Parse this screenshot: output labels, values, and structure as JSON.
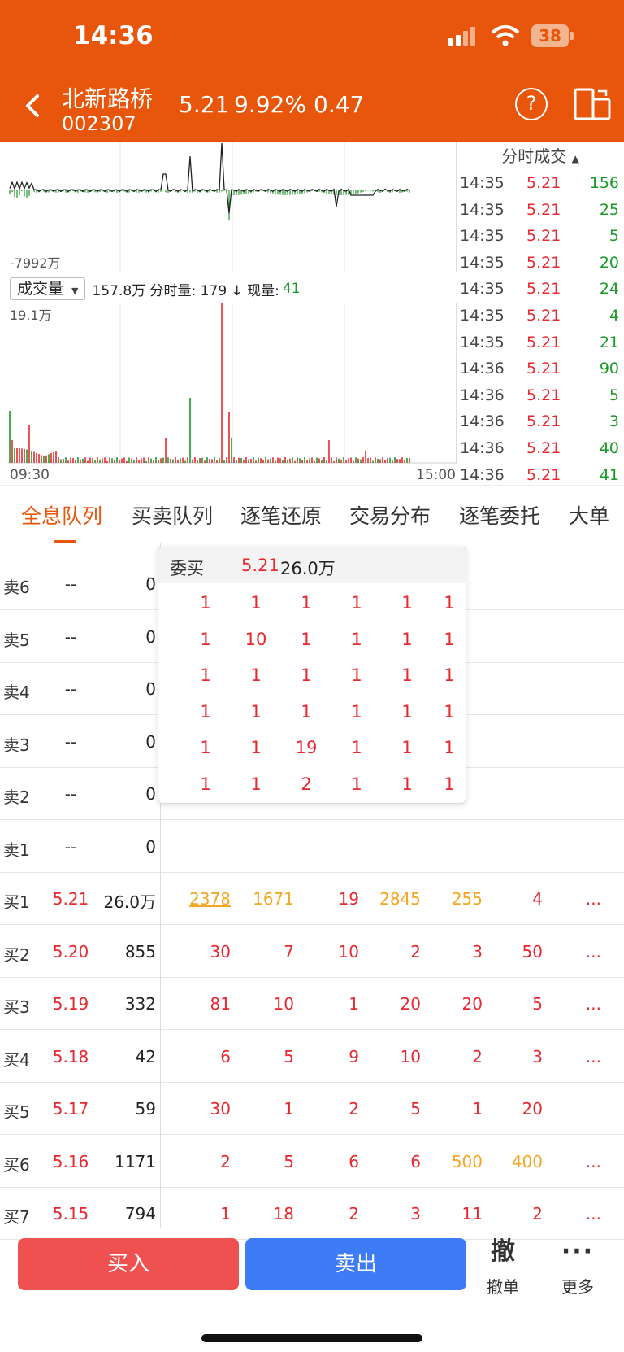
{
  "status": {
    "time": "14:36",
    "battery": "38"
  },
  "stock": {
    "name": "北新路桥",
    "code": "002307",
    "price": "5.21",
    "pct": "9.92%",
    "change": "0.47"
  },
  "chart": {
    "flow_label": "-7992万",
    "vol_select": "成交量",
    "vol_info": "157.8万 分时量: 179 ↓ 现量:",
    "vol_now": "41",
    "vol_max": "19.1万",
    "t_start": "09:30",
    "t_end": "15:00"
  },
  "ticks": {
    "header": "分时成交",
    "rows": [
      {
        "time": "14:35",
        "price": "5.21",
        "vol": "156"
      },
      {
        "time": "14:35",
        "price": "5.21",
        "vol": "25"
      },
      {
        "time": "14:35",
        "price": "5.21",
        "vol": "5"
      },
      {
        "time": "14:35",
        "price": "5.21",
        "vol": "20"
      },
      {
        "time": "14:35",
        "price": "5.21",
        "vol": "24"
      },
      {
        "time": "14:35",
        "price": "5.21",
        "vol": "4"
      },
      {
        "time": "14:35",
        "price": "5.21",
        "vol": "21"
      },
      {
        "time": "14:36",
        "price": "5.21",
        "vol": "90"
      },
      {
        "time": "14:36",
        "price": "5.21",
        "vol": "5"
      },
      {
        "time": "14:36",
        "price": "5.21",
        "vol": "3"
      },
      {
        "time": "14:36",
        "price": "5.21",
        "vol": "40"
      },
      {
        "time": "14:36",
        "price": "5.21",
        "vol": "41"
      }
    ]
  },
  "tabs": [
    "全息队列",
    "买卖队列",
    "逐笔还原",
    "交易分布",
    "逐笔委托",
    "大单"
  ],
  "popup": {
    "title": "委买",
    "price": "5.21",
    "vol": "26.0万",
    "grid": [
      [
        "1",
        "1",
        "1",
        "1",
        "1",
        "1"
      ],
      [
        "1",
        "10",
        "1",
        "1",
        "1",
        "1"
      ],
      [
        "1",
        "1",
        "1",
        "1",
        "1",
        "1"
      ],
      [
        "1",
        "1",
        "1",
        "1",
        "1",
        "1"
      ],
      [
        "1",
        "1",
        "19",
        "1",
        "1",
        "1"
      ],
      [
        "1",
        "1",
        "2",
        "1",
        "1",
        "1"
      ]
    ]
  },
  "sells": [
    {
      "label": "卖6",
      "price": "--",
      "vol": "0"
    },
    {
      "label": "卖5",
      "price": "--",
      "vol": "0"
    },
    {
      "label": "卖4",
      "price": "--",
      "vol": "0"
    },
    {
      "label": "卖3",
      "price": "--",
      "vol": "0"
    },
    {
      "label": "卖2",
      "price": "--",
      "vol": "0"
    },
    {
      "label": "卖1",
      "price": "--",
      "vol": "0"
    }
  ],
  "buys": [
    {
      "label": "买1",
      "price": "5.21",
      "vol": "26.0万",
      "q": [
        "2378",
        "1671",
        "19",
        "2845",
        "255",
        "4"
      ],
      "more": "..."
    },
    {
      "label": "买2",
      "price": "5.20",
      "vol": "855",
      "q": [
        "30",
        "7",
        "10",
        "2",
        "3",
        "50"
      ],
      "more": "..."
    },
    {
      "label": "买3",
      "price": "5.19",
      "vol": "332",
      "q": [
        "81",
        "10",
        "1",
        "20",
        "20",
        "5"
      ],
      "more": "..."
    },
    {
      "label": "买4",
      "price": "5.18",
      "vol": "42",
      "q": [
        "6",
        "5",
        "9",
        "10",
        "2",
        "3"
      ],
      "more": "..."
    },
    {
      "label": "买5",
      "price": "5.17",
      "vol": "59",
      "q": [
        "30",
        "1",
        "2",
        "5",
        "1",
        "20"
      ],
      "more": ""
    },
    {
      "label": "买6",
      "price": "5.16",
      "vol": "1171",
      "q": [
        "2",
        "5",
        "6",
        "6",
        "500",
        "400"
      ],
      "more": "..."
    },
    {
      "label": "买7",
      "price": "5.15",
      "vol": "794",
      "q": [
        "1",
        "18",
        "2",
        "3",
        "11",
        "2"
      ],
      "more": "..."
    }
  ],
  "actions": {
    "buy": "买入",
    "sell": "卖出",
    "cancel_icon": "撤",
    "cancel": "撤单",
    "more_icon": "···",
    "more": "更多"
  },
  "colors": {
    "header": "#E8560B",
    "up": "#E8272E",
    "down": "#1A9A27",
    "highlight": "#F5A623",
    "buy_btn": "#EE5150",
    "sell_btn": "#3D7BF7"
  }
}
